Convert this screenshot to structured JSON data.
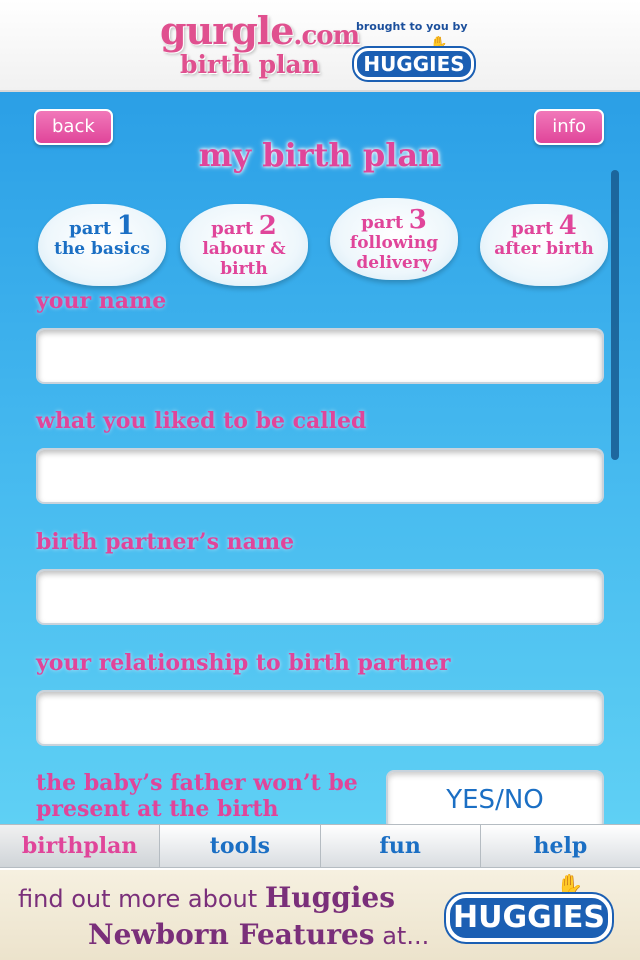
{
  "header": {
    "brand_main": "gurgle",
    "brand_dotcom": ".com",
    "brand_sub": "birth plan",
    "brought_by": "brought to you by",
    "sponsor_logo": "HUGGIES"
  },
  "nav": {
    "back_label": "back",
    "info_label": "info",
    "title": "my birth plan"
  },
  "parts": [
    {
      "prefix": "part",
      "num": "1",
      "label": "the basics"
    },
    {
      "prefix": "part",
      "num": "2",
      "label": "labour & birth"
    },
    {
      "prefix": "part",
      "num": "3",
      "label": "following delivery"
    },
    {
      "prefix": "part",
      "num": "4",
      "label": "after birth"
    }
  ],
  "form": {
    "fields": [
      {
        "label": "your name",
        "value": ""
      },
      {
        "label": "what you liked to be called",
        "value": ""
      },
      {
        "label": "birth partner’s name",
        "value": ""
      },
      {
        "label": "your relationship to birth partner",
        "value": ""
      }
    ],
    "father_question": "the baby’s father won’t be present at the birth",
    "father_answer": "YES/NO"
  },
  "tabbar": {
    "tabs": [
      "birthplan",
      "tools",
      "fun",
      "help"
    ],
    "active": "birthplan"
  },
  "footer": {
    "text_start": "find out more about",
    "brand": "Huggies",
    "feature": "Newborn Features",
    "text_end": "at...",
    "logo": "HUGGIES"
  },
  "colors": {
    "accent_pink": "#e0459a",
    "accent_blue": "#1b6fc4",
    "background_blue": "#45b9ef"
  }
}
